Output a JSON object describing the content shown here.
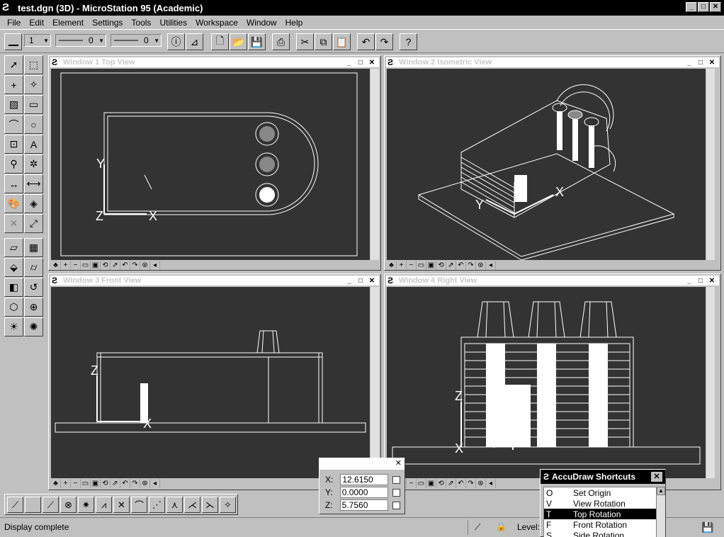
{
  "window": {
    "title": "test.dgn (3D) - MicroStation 95 (Academic)",
    "app_icon": "microstation-logo-icon",
    "minimize": "_",
    "maximize": "□",
    "close": "✕"
  },
  "menu": [
    "File",
    "Edit",
    "Element",
    "Settings",
    "Tools",
    "Utilities",
    "Workspace",
    "Window",
    "Help"
  ],
  "toolbar": {
    "weight_value": "1",
    "style_value": "0",
    "lineweight_value": "0"
  },
  "views": [
    {
      "title": "Window 1 Top View"
    },
    {
      "title": "Window 2 Isometric View"
    },
    {
      "title": "Window 3 Front View"
    },
    {
      "title": "Window 4 Right View"
    }
  ],
  "axis_labels": {
    "x": "X",
    "y": "Y",
    "z": "Z"
  },
  "coordinates": {
    "title": "",
    "x_label": "X:",
    "x_value": "12.6150",
    "y_label": "Y:",
    "y_value": "0.0000",
    "z_label": "Z:",
    "z_value": "5.7560"
  },
  "accudraw": {
    "title": "AccuDraw Shortcuts",
    "items": [
      {
        "key": "O",
        "label": "Set Origin"
      },
      {
        "key": "V",
        "label": "View Rotation"
      },
      {
        "key": "T",
        "label": "Top Rotation"
      },
      {
        "key": "F",
        "label": "Front Rotation"
      },
      {
        "key": "S",
        "label": "Side Rotation"
      }
    ],
    "selected_index": 2
  },
  "status": {
    "message": "Display complete",
    "level_label": "Level:"
  },
  "colors": {
    "canvas": "#333333",
    "chrome": "#c0c0c0",
    "titlebar": "#000000"
  }
}
